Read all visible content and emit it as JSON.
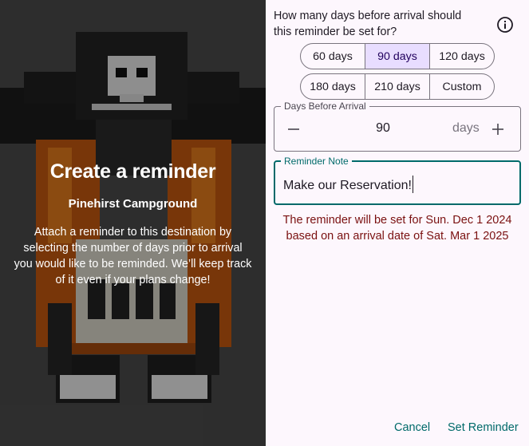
{
  "hero": {
    "title": "Create a reminder",
    "destination": "Pinehirst Campground",
    "description": "Attach a reminder to this destination by selecting the number of days prior to arrival you would like to be reminded. We’ll keep track of it even if your plans change!",
    "artwork": "pixel-art-pirate-figure"
  },
  "dialog": {
    "question": "How many days before arrival should this reminder be set for?",
    "info_icon": "info-icon",
    "options_row1": [
      "60 days",
      "90 days",
      "120 days"
    ],
    "options_row2": [
      "180 days",
      "210 days",
      "Custom"
    ],
    "selected_option": "90 days",
    "days_field": {
      "label": "Days Before Arrival",
      "value": "90",
      "suffix": "days",
      "decrement_icon": "minus-icon",
      "increment_icon": "plus-icon"
    },
    "note_field": {
      "label": "Reminder Note",
      "value": "Make our Reservation!"
    },
    "summary_line1": "The reminder will be set for Sun. Dec 1 2024",
    "summary_line2": "based on an arrival date of Sat. Mar 1 2025",
    "cancel_label": "Cancel",
    "set_label": "Set Reminder"
  },
  "colors": {
    "accent": "#006a6a",
    "selected_segment": "#e8ddff",
    "summary_text": "#7a1010",
    "panel_background": "#fdf7fd"
  }
}
